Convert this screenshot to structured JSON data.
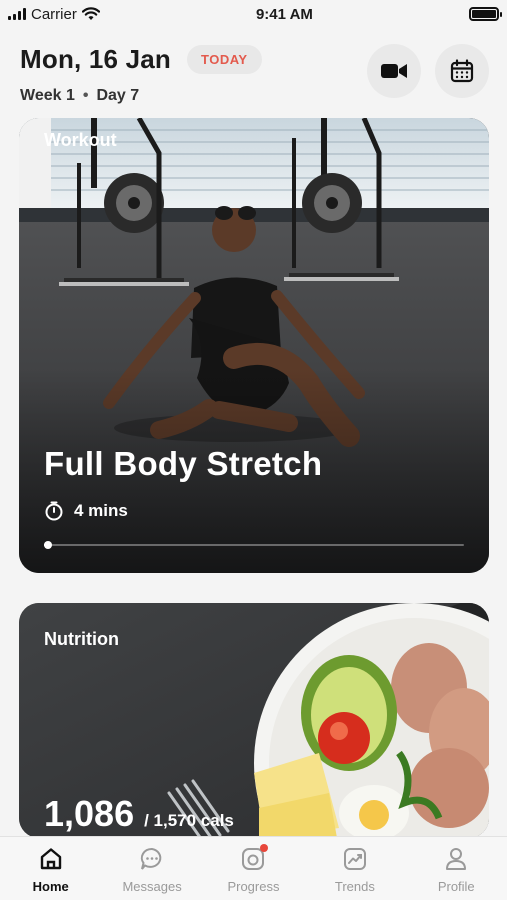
{
  "status_bar": {
    "carrier": "Carrier",
    "time": "9:41 AM"
  },
  "header": {
    "date": "Mon, 16 Jan",
    "badge": "TODAY",
    "week": "Week 1",
    "separator": "•",
    "day": "Day 7",
    "video_icon": "video-camera-icon",
    "calendar_icon": "calendar-icon"
  },
  "workout": {
    "tag": "Workout",
    "title": "Full Body Stretch",
    "duration": "4 mins",
    "progress": 0.01
  },
  "nutrition": {
    "tag": "Nutrition",
    "calories": "1,086",
    "goal": "/ 1,570 cals"
  },
  "tabs": [
    {
      "label": "Home",
      "icon": "home-icon",
      "active": true
    },
    {
      "label": "Messages",
      "icon": "chat-icon",
      "active": false
    },
    {
      "label": "Progress",
      "icon": "camera-icon",
      "active": false,
      "badge": true
    },
    {
      "label": "Trends",
      "icon": "trend-icon",
      "active": false
    },
    {
      "label": "Profile",
      "icon": "profile-icon",
      "active": false
    }
  ],
  "colors": {
    "accent_red": "#e35a4d",
    "notification_dot": "#e8473b"
  }
}
